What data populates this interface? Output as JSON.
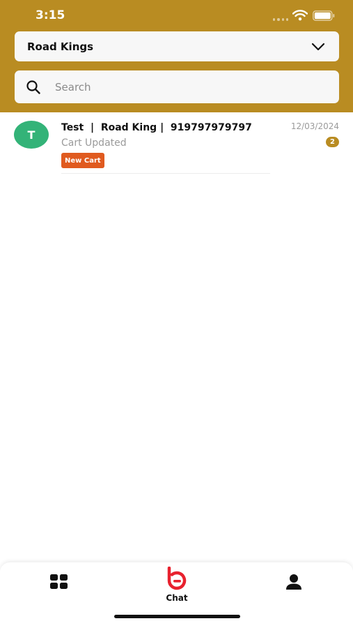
{
  "status_bar": {
    "time": "3:15"
  },
  "header": {
    "dropdown": {
      "selected": "Road Kings",
      "icon": "chevron-down-icon"
    },
    "search": {
      "placeholder": "Search",
      "value": "",
      "icon": "search-icon"
    }
  },
  "conversations": [
    {
      "avatar_letter": "T",
      "title": "Test  |  Road King |  919797979797",
      "subtitle": "Cart Updated",
      "date": "12/03/2024",
      "unread_count": "2",
      "tag": "New Cart"
    }
  ],
  "bottom_nav": {
    "items": [
      {
        "icon": "grid-icon",
        "label": ""
      },
      {
        "icon": "chat-logo-icon",
        "label": "Chat",
        "active": true
      },
      {
        "icon": "profile-icon",
        "label": ""
      }
    ]
  },
  "colors": {
    "header": "#b98c22",
    "avatar": "#33b378",
    "tag": "#e05a1f",
    "badge": "#b98c22",
    "chat_logo": "#e8212e"
  }
}
